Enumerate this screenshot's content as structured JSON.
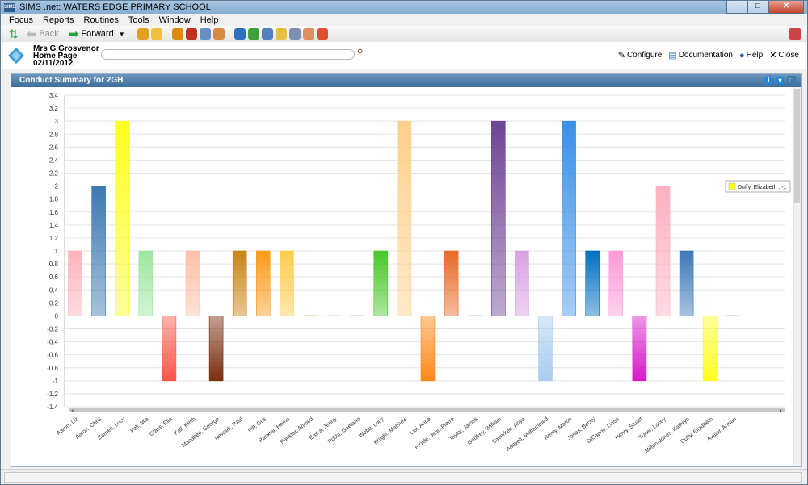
{
  "window": {
    "app_badge": "SIMS",
    "title": "SIMS .net: WATERS EDGE PRIMARY SCHOOL",
    "min": "–",
    "max": "□",
    "close": "✕"
  },
  "menu": [
    "Focus",
    "Reports",
    "Routines",
    "Tools",
    "Window",
    "Help"
  ],
  "toolbar": {
    "back_label": "Back",
    "forward_label": "Forward"
  },
  "header": {
    "user_name": "Mrs G Grosvenor",
    "page": "Home Page",
    "date": "02/11/2012",
    "configure": "Configure",
    "documentation": "Documentation",
    "help": "Help",
    "close": "Close"
  },
  "panel": {
    "title": "Conduct Summary for 2GH"
  },
  "chart_data": {
    "type": "bar",
    "title": "Conduct Summary for 2GH",
    "ylim": [
      -1.4,
      3.4
    ],
    "yticks": [
      3.4,
      3.2,
      3,
      2.8,
      2.6,
      2.4,
      2.2,
      2,
      1.8,
      1.6,
      1.4,
      1.2,
      1,
      0.8,
      0.6,
      0.4,
      0.2,
      0,
      -0.2,
      -0.4,
      -0.6,
      -0.8,
      -1,
      -1.2,
      -1.4
    ],
    "grid": true,
    "categories": [
      "Aaron, Liz",
      "Aaron, Chris",
      "Barnes, Lucy",
      "Fell, Mia",
      "Glass, Ella",
      "Kall, Keith",
      "Macabee, George",
      "Newark, Paul",
      "Pill, Gus",
      "Panktar, Hema",
      "Panktar, Ahmed",
      "Basra, Jenny",
      "Polita, Gaetano",
      "Webb, Lucy",
      "Knight, Matthew",
      "Lisi, Anna",
      "Froide, Jean-Pierre",
      "Taylor, James",
      "Godfrey, William",
      "Saverkee, Anya",
      "Adeyeli, Mohammed",
      "Remy, Martin",
      "Jonas, Becky",
      "DiCaprio, Luisa",
      "Henry, Stuart",
      "Tuner, Lacey",
      "Milton-Jones, Kathryn",
      "Duffy, Elizabeth",
      "Avatar, Arman"
    ],
    "values": [
      1,
      2,
      3,
      1,
      -1,
      1,
      -1,
      1,
      1,
      1,
      0,
      0,
      0,
      1,
      3,
      -1,
      1,
      0,
      3,
      1,
      -1,
      3,
      1,
      1,
      -1,
      2,
      1,
      -1,
      0
    ],
    "colors": [
      "#ffb3bd",
      "#3d78b0",
      "#ffff1e",
      "#9ee6a0",
      "#ff5548",
      "#ffc0a8",
      "#7a2e10",
      "#c88416",
      "#ff9a18",
      "#ffcc4c",
      "#c8e0a0",
      "#d8e6a8",
      "#c0e0b0",
      "#48c828",
      "#ffd08a",
      "#ff8818",
      "#e86a28",
      "#b8e0d0",
      "#6e4494",
      "#d8a0e4",
      "#a8ccf0",
      "#3a90e8",
      "#0070c0",
      "#ff9ad8",
      "#d818c8",
      "#ffb0c0",
      "#3c78b8",
      "#ffff20",
      "#a8e0c8"
    ],
    "tooltip": "Duffy, Elizabeth : -1"
  }
}
